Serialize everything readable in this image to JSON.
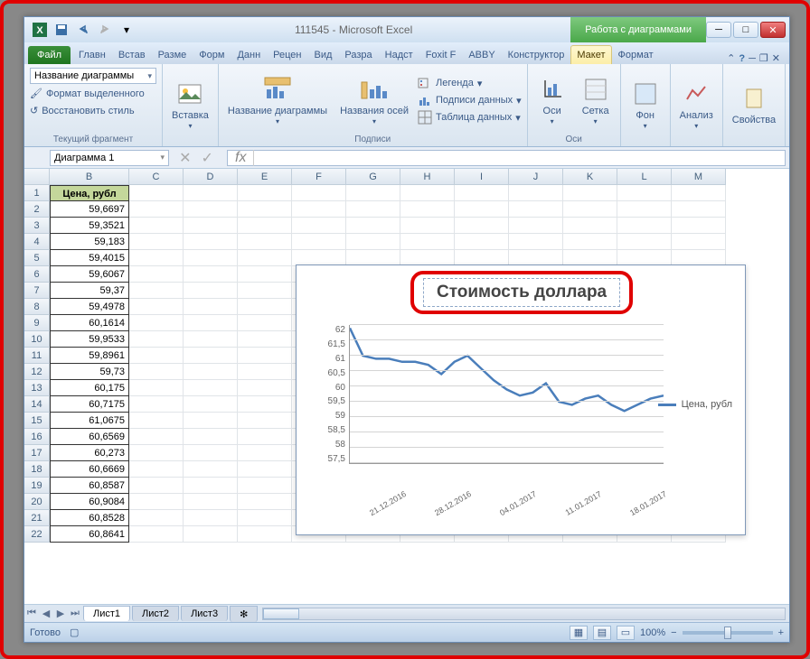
{
  "title": {
    "doc": "111545",
    "app": "Microsoft Excel",
    "chart_tools": "Работа с диаграммами"
  },
  "tabs": {
    "file": "Файл",
    "list": [
      "Главн",
      "Встав",
      "Разме",
      "Форм",
      "Данн",
      "Рецен",
      "Вид",
      "Разра",
      "Надст",
      "Foxit F",
      "ABBY"
    ],
    "chart": [
      "Конструктор",
      "Макет",
      "Формат"
    ],
    "active": "Макет"
  },
  "ribbon": {
    "g1": {
      "combo": "Название диаграммы",
      "a": "Формат выделенного",
      "b": "Восстановить стиль",
      "label": "Текущий фрагмент"
    },
    "g2": {
      "a": "Вставка"
    },
    "g3": {
      "a": "Название диаграммы",
      "b": "Названия осей",
      "c": "Легенда",
      "d": "Подписи данных",
      "e": "Таблица данных",
      "label": "Подписи"
    },
    "g4": {
      "a": "Оси",
      "b": "Сетка",
      "label": "Оси"
    },
    "g5": {
      "a": "Фон"
    },
    "g6": {
      "a": "Анализ"
    },
    "g7": {
      "a": "Свойства"
    }
  },
  "namebox": "Диаграмма 1",
  "columns": [
    "B",
    "C",
    "D",
    "E",
    "F",
    "G",
    "H",
    "I",
    "J",
    "K",
    "L",
    "M"
  ],
  "header_b": "Цена, рубл",
  "prices": [
    "59,6697",
    "59,3521",
    "59,183",
    "59,4015",
    "59,6067",
    "59,37",
    "59,4978",
    "60,1614",
    "59,9533",
    "59,8961",
    "59,73",
    "60,175",
    "60,7175",
    "61,0675",
    "60,6569",
    "60,273",
    "60,6669",
    "60,8587",
    "60,9084",
    "60,8528",
    "60,8641"
  ],
  "chart_data": {
    "type": "line",
    "title": "Стоимость доллара",
    "series": [
      {
        "name": "Цена, рубл",
        "values": [
          61.9,
          61.0,
          60.9,
          60.9,
          60.8,
          60.8,
          60.7,
          60.4,
          60.8,
          61.0,
          60.6,
          60.2,
          59.9,
          59.7,
          59.8,
          60.1,
          59.5,
          59.4,
          59.6,
          59.7,
          59.4,
          59.2,
          59.4,
          59.6,
          59.7
        ]
      }
    ],
    "x_categories": [
      "21.12.2016",
      "28.12.2016",
      "04.01.2017",
      "11.01.2017",
      "18.01.2017"
    ],
    "y_ticks": [
      "57,5",
      "58",
      "58,5",
      "59",
      "59,5",
      "60",
      "60,5",
      "61",
      "61,5",
      "62"
    ],
    "ylim": [
      57.5,
      62
    ],
    "legend": "Цена, рубл"
  },
  "sheets": [
    "Лист1",
    "Лист2",
    "Лист3"
  ],
  "status": {
    "ready": "Готово",
    "zoom": "100%"
  }
}
